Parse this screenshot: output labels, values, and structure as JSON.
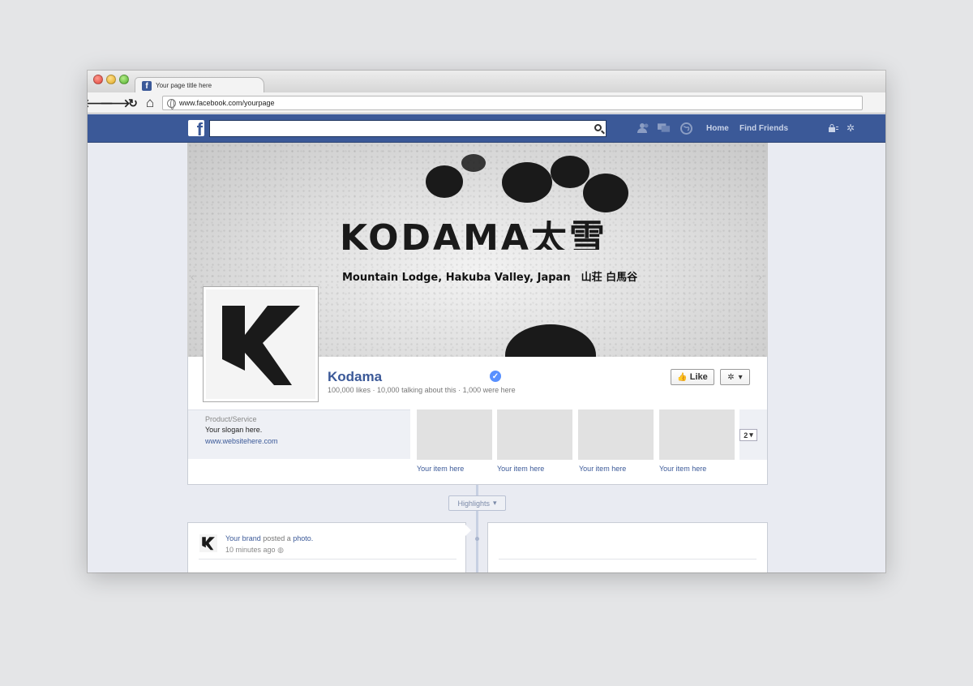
{
  "browser": {
    "tab_title": "Your page title here",
    "url": "www.facebook.com/yourpage",
    "back_glyph": "🡐",
    "forward_glyph": "🡒",
    "reload_glyph": "↻",
    "home_glyph": "⌂"
  },
  "fb_nav": {
    "logo_letter": "f",
    "links": [
      "Home",
      "Find Friends"
    ],
    "icons": [
      "friend-requests-icon",
      "messages-icon",
      "notifications-icon",
      "privacy-shortcuts-icon",
      "settings-gear-icon"
    ]
  },
  "cover": {
    "title": "KODAMA太雪",
    "subtitle": "Mountain Lodge, Hakuba Valley, Japan　山荘 白馬谷"
  },
  "page": {
    "name": "Kodama",
    "stats": "100,000 likes · 10,000 talking about this · 1,000 were here",
    "like_label": "Like",
    "verified_glyph": "✓",
    "gear_glyph": "✲"
  },
  "about": {
    "category": "Product/Service",
    "slogan": "Your slogan here.",
    "website": "www.websitehere.com"
  },
  "apps": [
    {
      "label": "Your item here"
    },
    {
      "label": "Your item here"
    },
    {
      "label": "Your item here"
    },
    {
      "label": "Your item here"
    }
  ],
  "apps_more": "2",
  "timeline": {
    "highlights_label": "Highlights"
  },
  "post": {
    "author": "Your brand",
    "action": "posted a",
    "object": "photo.",
    "time": "10 minutes ago"
  },
  "colors": {
    "fb_blue": "#3b5998",
    "link_blue": "#3b5998",
    "verified_blue": "#5890ff"
  }
}
